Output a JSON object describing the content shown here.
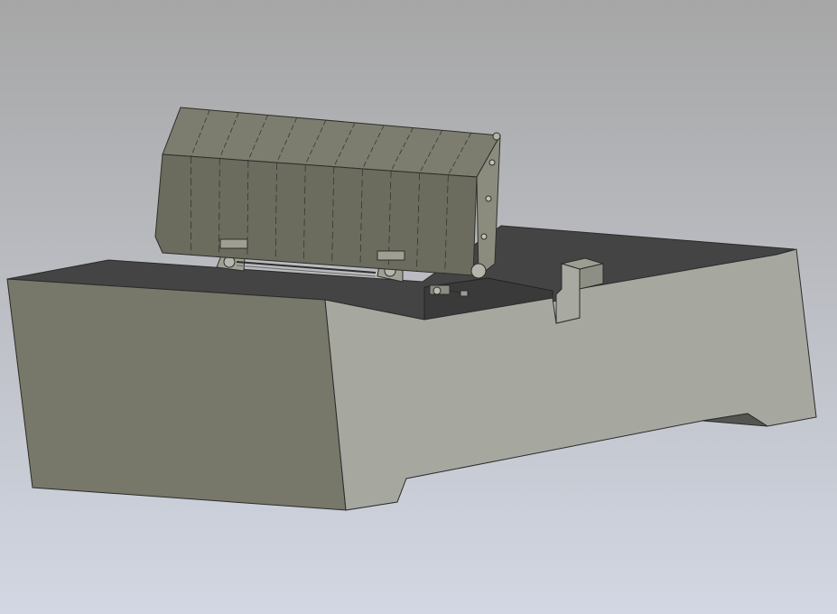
{
  "viewport": {
    "background_top": "#a6a6a6",
    "background_bottom": "#d2d7e3"
  },
  "model": {
    "body_colors": {
      "left_face": "#777869",
      "front_face": "#a6a79f",
      "top_face": "#444444",
      "edge": "#2b2b2b"
    },
    "blade_colors": {
      "main": "#7c7d6e",
      "shade": "#6b6c5e",
      "line": "#2e2e2a"
    },
    "blade_ribs": 11
  }
}
